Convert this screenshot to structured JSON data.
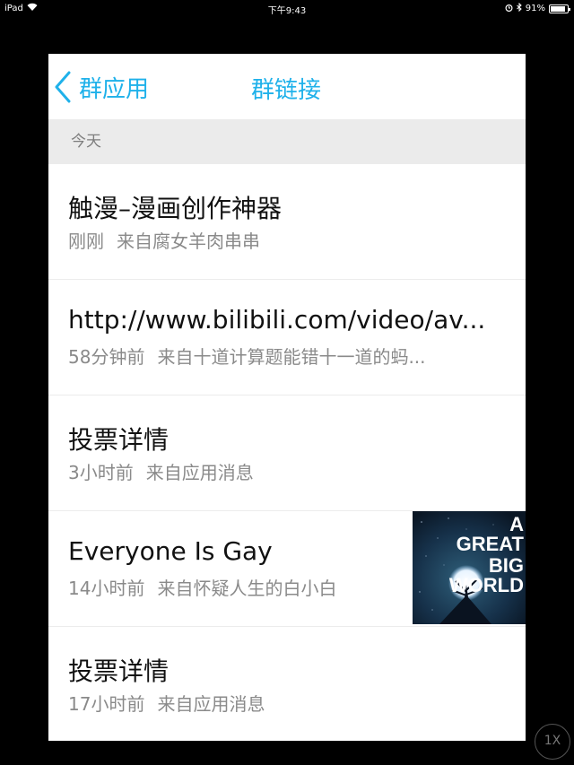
{
  "status_bar": {
    "device": "iPad",
    "time": "下午9:43",
    "battery": "91%",
    "battery_level": 0.91
  },
  "nav": {
    "back_label": "群应用",
    "title": "群链接"
  },
  "section": {
    "header": "今天"
  },
  "items": [
    {
      "title": "触漫–漫画创作神器",
      "time": "刚刚",
      "source": "来自腐女羊肉串串"
    },
    {
      "title": "http://www.bilibili.com/video/av...",
      "time": "58分钟前",
      "source": "来自十道计算题能错十一道的蚂..."
    },
    {
      "title": "投票详情",
      "time": "3小时前",
      "source": "来自应用消息"
    },
    {
      "title": "Everyone Is Gay",
      "time": "14小时前",
      "source": "来自怀疑人生的白小白",
      "thumbnail": {
        "lines": [
          "A",
          "GREAT",
          "BIG",
          "WORLD"
        ]
      }
    },
    {
      "title": "投票详情",
      "time": "17小时前",
      "source": "来自应用消息"
    }
  ],
  "zoom_button": "1X"
}
